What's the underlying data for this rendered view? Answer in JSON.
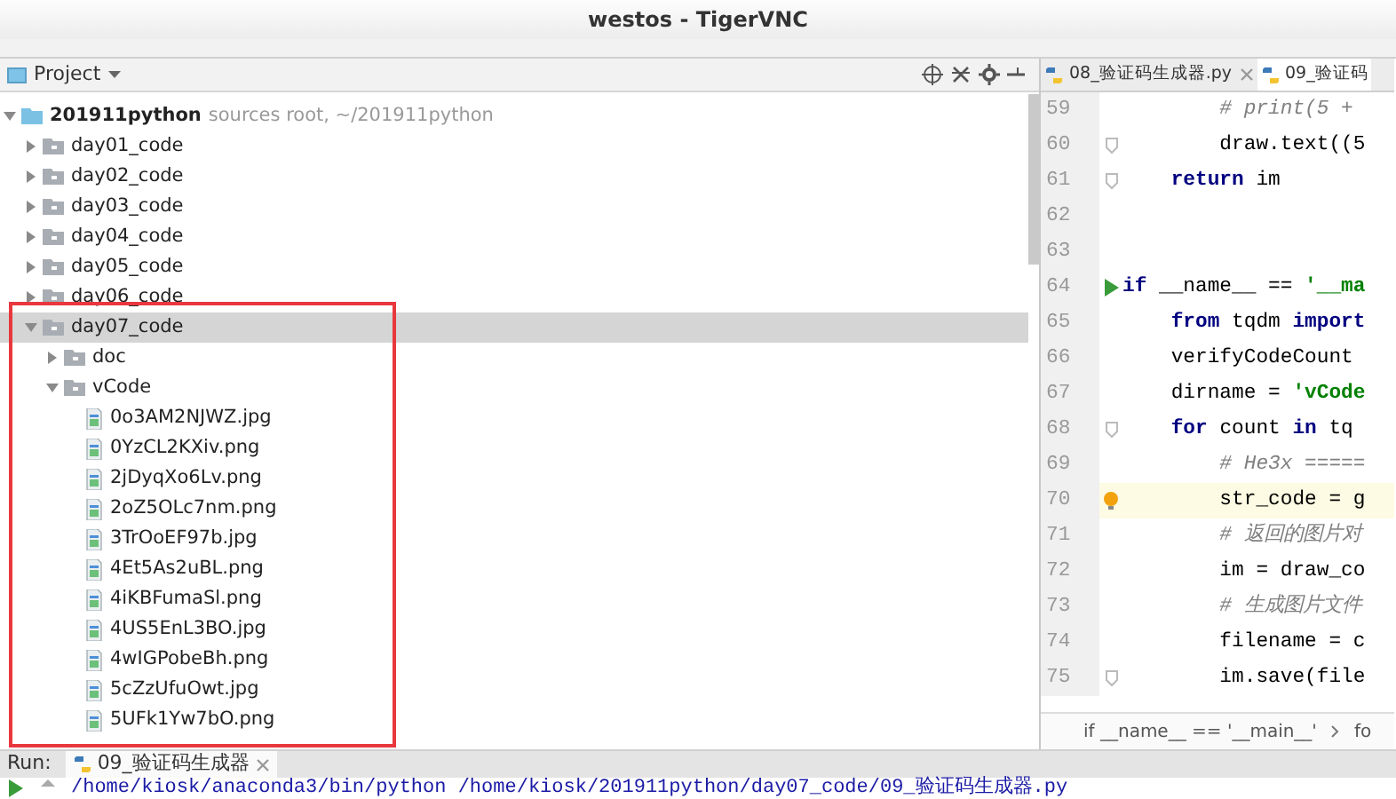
{
  "window": {
    "title": "westos - TigerVNC"
  },
  "project_panel": {
    "title": "Project",
    "tree": [
      {
        "label": "201911python",
        "hint": "sources root, ~/201911python",
        "kind": "root",
        "expanded": true,
        "selected": false,
        "children": [
          {
            "label": "day01_code",
            "kind": "folder",
            "expanded": false,
            "selected": false
          },
          {
            "label": "day02_code",
            "kind": "folder",
            "expanded": false,
            "selected": false
          },
          {
            "label": "day03_code",
            "kind": "folder",
            "expanded": false,
            "selected": false
          },
          {
            "label": "day04_code",
            "kind": "folder",
            "expanded": false,
            "selected": false
          },
          {
            "label": "day05_code",
            "kind": "folder",
            "expanded": false,
            "selected": false
          },
          {
            "label": "day06_code",
            "kind": "folder",
            "expanded": false,
            "selected": false
          },
          {
            "label": "day07_code",
            "kind": "folder",
            "expanded": true,
            "selected": true,
            "children": [
              {
                "label": "doc",
                "kind": "folder",
                "expanded": false,
                "selected": false
              },
              {
                "label": "vCode",
                "kind": "folder",
                "expanded": true,
                "selected": false,
                "children": [
                  {
                    "label": "0o3AM2NJWZ.jpg",
                    "kind": "file",
                    "selected": false
                  },
                  {
                    "label": "0YzCL2KXiv.png",
                    "kind": "file",
                    "selected": false
                  },
                  {
                    "label": "2jDyqXo6Lv.png",
                    "kind": "file",
                    "selected": false
                  },
                  {
                    "label": "2oZ5OLc7nm.png",
                    "kind": "file",
                    "selected": false
                  },
                  {
                    "label": "3TrOoEF97b.jpg",
                    "kind": "file",
                    "selected": false
                  },
                  {
                    "label": "4Et5As2uBL.png",
                    "kind": "file",
                    "selected": false
                  },
                  {
                    "label": "4iKBFumaSl.png",
                    "kind": "file",
                    "selected": false
                  },
                  {
                    "label": "4US5EnL3BO.jpg",
                    "kind": "file",
                    "selected": false
                  },
                  {
                    "label": "4wIGPobeBh.png",
                    "kind": "file",
                    "selected": false
                  },
                  {
                    "label": "5cZzUfuOwt.jpg",
                    "kind": "file",
                    "selected": false
                  },
                  {
                    "label": "5UFk1Yw7bO.png",
                    "kind": "file",
                    "selected": false
                  }
                ]
              }
            ]
          }
        ]
      }
    ]
  },
  "editor": {
    "tabs": [
      {
        "label": "08_验证码生成器.py",
        "selected": false
      },
      {
        "label": "09_验证码",
        "selected": true
      }
    ],
    "lines": [
      {
        "number": "59",
        "kind": "plain",
        "current": false,
        "segments": [
          {
            "kind": "comment",
            "text": "        # print(5 +"
          }
        ]
      },
      {
        "number": "60",
        "kind": "fold",
        "current": false,
        "segments": [
          {
            "kind": "plain",
            "text": "        draw.text((5"
          }
        ]
      },
      {
        "number": "61",
        "kind": "fold",
        "current": false,
        "segments": [
          {
            "kind": "keyword",
            "text": "    return"
          },
          {
            "kind": "plain",
            "text": " im"
          }
        ]
      },
      {
        "number": "62",
        "kind": "plain",
        "current": false
      },
      {
        "number": "63",
        "kind": "plain",
        "current": false
      },
      {
        "number": "64",
        "kind": "run",
        "current": false,
        "segments": [
          {
            "kind": "keyword",
            "text": "if"
          },
          {
            "kind": "plain",
            "text": " __name__ == "
          },
          {
            "kind": "string",
            "text": "'__ma"
          }
        ]
      },
      {
        "number": "65",
        "kind": "plain",
        "current": false,
        "segments": [
          {
            "kind": "keyword",
            "text": "    from"
          },
          {
            "kind": "plain",
            "text": " tqdm "
          },
          {
            "kind": "keyword",
            "text": "import"
          }
        ]
      },
      {
        "number": "66",
        "kind": "plain",
        "current": false,
        "segments": [
          {
            "kind": "plain",
            "text": "    verifyCodeCount"
          }
        ]
      },
      {
        "number": "67",
        "kind": "plain",
        "current": false,
        "segments": [
          {
            "kind": "plain",
            "text": "    dirname = "
          },
          {
            "kind": "string",
            "text": "'vCode"
          }
        ]
      },
      {
        "number": "68",
        "kind": "fold",
        "current": false,
        "segments": [
          {
            "kind": "keyword",
            "text": "    for"
          },
          {
            "kind": "plain",
            "text": " count "
          },
          {
            "kind": "keyword",
            "text": "in"
          },
          {
            "kind": "plain",
            "text": " tq"
          }
        ]
      },
      {
        "number": "69",
        "kind": "plain",
        "current": false,
        "segments": [
          {
            "kind": "comment",
            "text": "        # He3x ====="
          }
        ]
      },
      {
        "number": "70",
        "kind": "bulb",
        "current": true,
        "segments": [
          {
            "kind": "plain",
            "text": "        str_code = g"
          }
        ]
      },
      {
        "number": "71",
        "kind": "plain",
        "current": false,
        "segments": [
          {
            "kind": "comment",
            "text": "        # 返回的图片对"
          }
        ]
      },
      {
        "number": "72",
        "kind": "plain",
        "current": false,
        "segments": [
          {
            "kind": "plain",
            "text": "        im = draw_co"
          }
        ]
      },
      {
        "number": "73",
        "kind": "plain",
        "current": false,
        "segments": [
          {
            "kind": "comment",
            "text": "        # 生成图片文件"
          }
        ]
      },
      {
        "number": "74",
        "kind": "plain",
        "current": false,
        "segments": [
          {
            "kind": "plain",
            "text": "        filename = c"
          }
        ]
      },
      {
        "number": "75",
        "kind": "fold",
        "current": false,
        "segments": [
          {
            "kind": "plain",
            "text": "        im.save(file"
          }
        ]
      }
    ],
    "breadcrumb": [
      "if __name__ == '__main__'",
      "fo"
    ]
  },
  "run_panel": {
    "label": "Run:",
    "tabs": [
      {
        "label": "09_验证码生成器",
        "selected": true
      }
    ],
    "console": "/home/kiosk/anaconda3/bin/python /home/kiosk/201911python/day07_code/09_验证码生成器.py"
  }
}
